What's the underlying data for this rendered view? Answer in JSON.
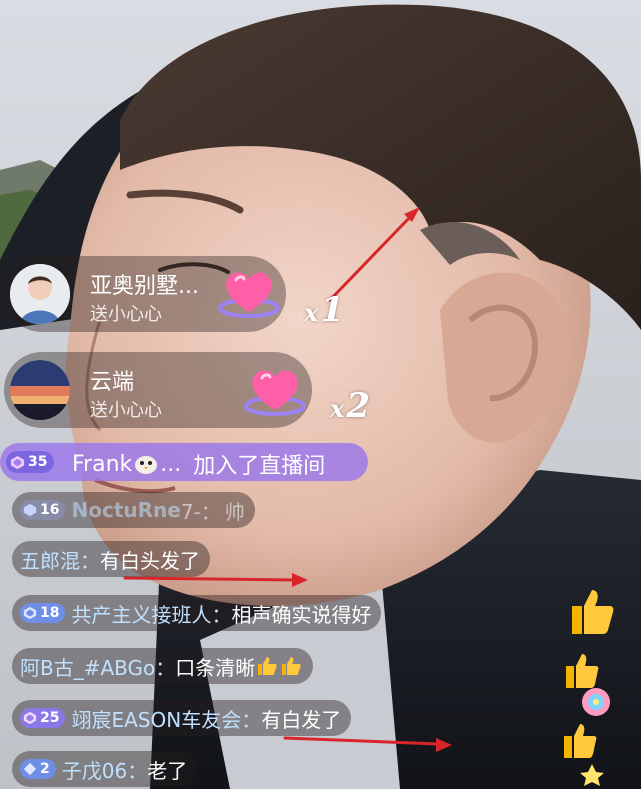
{
  "gifts": [
    {
      "user": "亚奥别墅...",
      "action": "送小心心",
      "gift_icon": "heart-gift-icon",
      "count_prefix": "x",
      "count": "1"
    },
    {
      "user": "云端",
      "action": "送小心心",
      "gift_icon": "heart-gift-icon",
      "count_prefix": "x",
      "count": "2"
    }
  ],
  "join": {
    "level": "35",
    "user": "Frank",
    "emoji": "bird-emoji-icon",
    "ellipsis": "...",
    "text": "加入了直播间"
  },
  "chat": [
    {
      "level": "16",
      "user": "NoctuRne",
      "sep": " 7-：",
      "message": "帅",
      "faded": true
    },
    {
      "level": "",
      "user": "五郎混：",
      "sep": "",
      "message": "有白头发了"
    },
    {
      "level": "18",
      "user": "共产主义接班人：",
      "sep": "",
      "message": "相声确实说得好"
    },
    {
      "level": "",
      "user": "阿B古_#ABGo：",
      "sep": "",
      "message": "口条清晰",
      "emoji": "thumbs-up-icon"
    },
    {
      "level": "25",
      "user": "翊宸EASON车友会：",
      "sep": "",
      "message": "有白发了"
    },
    {
      "level": "2",
      "user": "子戊06：",
      "sep": "",
      "message": "老了"
    }
  ],
  "colors": {
    "badge_purple": "#8a78e8",
    "badge_blue": "#6f8fe6",
    "join_pill": "#9a76eb",
    "username": "#bfe1ff",
    "arrow_red": "#d8252a"
  }
}
